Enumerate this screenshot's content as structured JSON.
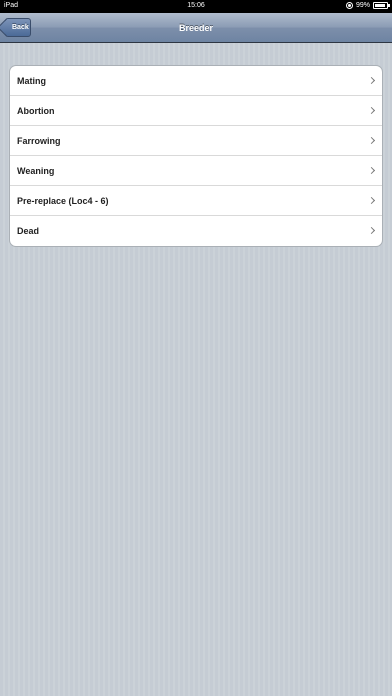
{
  "status_bar": {
    "carrier": "iPad",
    "time": "15:06",
    "battery": "99%"
  },
  "nav_bar": {
    "title": "Breeder",
    "back_label": "Back"
  },
  "menu": {
    "items": [
      {
        "label": "Mating"
      },
      {
        "label": "Abortion"
      },
      {
        "label": "Farrowing"
      },
      {
        "label": "Weaning"
      },
      {
        "label": "Pre-replace (Loc4 - 6)"
      },
      {
        "label": "Dead"
      }
    ]
  },
  "colors": {
    "nav_bar": "#8a9bb4",
    "background": "#c5ccd4",
    "list_background": "#ffffff"
  }
}
